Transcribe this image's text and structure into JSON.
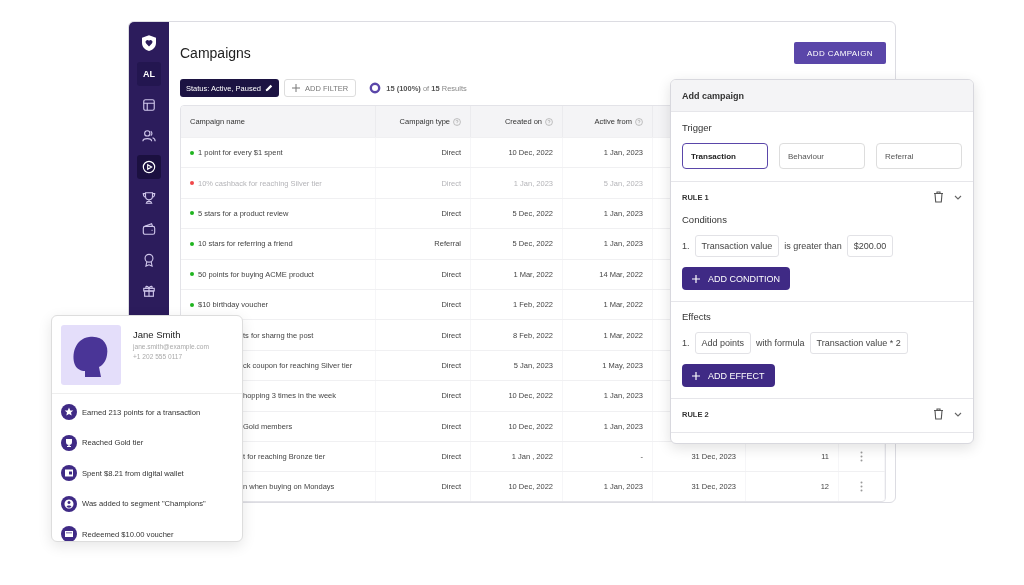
{
  "app": {
    "sidebar": {
      "avatar": "AL",
      "items": [
        {
          "kind": "layout",
          "selected": false
        },
        {
          "kind": "users",
          "selected": false
        },
        {
          "kind": "play",
          "selected": true
        },
        {
          "kind": "trophy",
          "selected": false
        },
        {
          "kind": "wallet",
          "selected": false
        },
        {
          "kind": "badge",
          "selected": false
        },
        {
          "kind": "gift",
          "selected": false
        }
      ]
    },
    "title": "Campaigns",
    "add_button": "ADD CAMPAIGN",
    "filters": {
      "active": "Status: Active, Paused",
      "add": "ADD FILTER",
      "results": "**15 (100%)** of **15** Results"
    },
    "table": {
      "columns": [
        {
          "label": "Campaign name",
          "info": false
        },
        {
          "label": "Campaign type",
          "info": true
        },
        {
          "label": "Created on",
          "info": true
        },
        {
          "label": "Active from",
          "info": true
        }
      ],
      "rows": [
        {
          "name": "1 point for every $1 spent",
          "color": "#1fb41f",
          "disabled": false,
          "type": "Direct",
          "created": "10 Dec, 2022",
          "active_from": "1 Jan, 2023"
        },
        {
          "name": "10% cashback for reaching Silver tier",
          "color": "#f0474a",
          "disabled": true,
          "type": "Direct",
          "created": "1 Jan, 2023",
          "active_from": "5 Jan, 2023"
        },
        {
          "name": "5 stars for a product review",
          "color": "#1fb41f",
          "disabled": false,
          "type": "Direct",
          "created": "5 Dec, 2022",
          "active_from": "1 Jan, 2023"
        },
        {
          "name": "10 stars for referring a friend",
          "color": "#1fb41f",
          "disabled": false,
          "type": "Referral",
          "created": "5 Dec, 2022",
          "active_from": "1 Jan, 2023"
        },
        {
          "name": "50 points for buying ACME product",
          "color": "#1fb41f",
          "disabled": false,
          "type": "Direct",
          "created": "1 Mar, 2022",
          "active_from": "14 Mar, 2022"
        },
        {
          "name": "$10 birthday voucher",
          "color": "#1fb41f",
          "disabled": false,
          "type": "Direct",
          "created": "1 Feb, 2022",
          "active_from": "1 Mar, 2022"
        },
        {
          "name": "ts for sharng the post",
          "disabled": false,
          "type": "Direct",
          "created": "8 Feb, 2022",
          "active_from": "1 Mar, 2022"
        },
        {
          "name": "ck coupon for reaching Silver tier",
          "disabled": false,
          "type": "Direct",
          "created": "5 Jan, 2023",
          "active_from": "1 May, 2023"
        },
        {
          "name": "hopping 3 times in the week",
          "disabled": false,
          "type": "Direct",
          "created": "10 Dec, 2022",
          "active_from": "1 Jan, 2023"
        },
        {
          "name": "Gold members",
          "disabled": false,
          "type": "Direct",
          "created": "10 Dec, 2022",
          "active_from": "1 Jan, 2023"
        },
        {
          "name": "t for reaching Bronze tier",
          "disabled": false,
          "type": "Direct",
          "created": "1 Jan , 2022",
          "active_from": "-",
          "column_5": "31 Dec, 2023",
          "column_6": "11"
        },
        {
          "name": "n when buying on Mondays",
          "disabled": false,
          "type": "Direct",
          "created": "10 Dec, 2022",
          "active_from": "1 Jan, 2023",
          "column_5": "31 Dec, 2023",
          "column_6": "12"
        }
      ]
    }
  },
  "add_campaign": {
    "title": "Add campaign",
    "trigger_label": "Trigger",
    "trigger_options": [
      {
        "label": "Transaction",
        "selected": true
      },
      {
        "label": "Behaviour",
        "selected": false
      },
      {
        "label": "Referral",
        "selected": false
      }
    ],
    "rules": [
      {
        "title": "RULE 1",
        "conditions_label": "Conditions",
        "conditions": [
          {
            "number": "1.",
            "field": "Transaction value",
            "operator": "is greater than",
            "value": "$200.00"
          }
        ],
        "add_condition": "ADD CONDITION",
        "effects_label": "Effects",
        "effects": [
          {
            "number": "1.",
            "action": "Add points",
            "connector": "with formula",
            "formula": "Transaction value * 2"
          }
        ],
        "add_effect": "ADD EFFECT"
      },
      {
        "title": "RULE 2"
      }
    ]
  },
  "profile": {
    "name": "Jane Smith",
    "email": "jane.smith@example.com",
    "phone": "+1 202 555 0117",
    "activities": [
      {
        "kind": "star",
        "text": "Earned 213 points for a transaction"
      },
      {
        "kind": "trophy",
        "text": "Reached Gold tier"
      },
      {
        "kind": "wallet",
        "text": "Spent $8.21 from digital wallet"
      },
      {
        "kind": "user",
        "text": "Was added to segment \"Champions\""
      },
      {
        "kind": "voucher",
        "text": "Redeemed $10.00 voucher"
      }
    ]
  }
}
